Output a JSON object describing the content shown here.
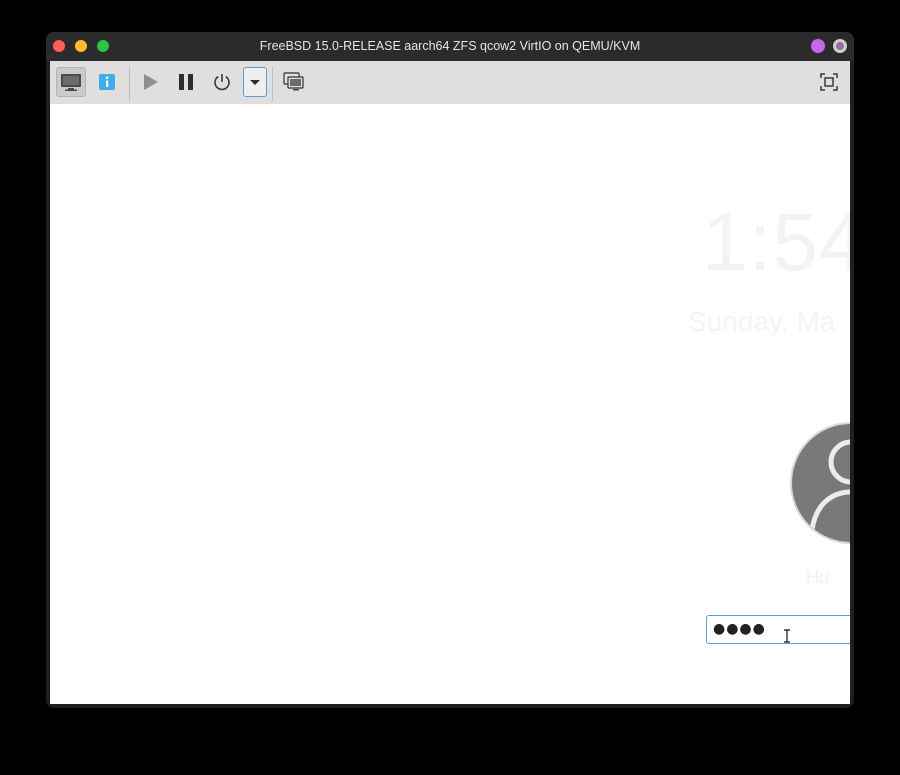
{
  "window": {
    "title": "FreeBSD 15.0-RELEASE aarch64 ZFS qcow2 VirtIO on QEMU/KVM"
  },
  "toolbar": {
    "buttons": [
      {
        "name": "display-console",
        "icon": "monitor-icon"
      },
      {
        "name": "details",
        "icon": "info-icon"
      },
      {
        "name": "run",
        "icon": "play-icon"
      },
      {
        "name": "pause",
        "icon": "pause-icon"
      },
      {
        "name": "shutdown",
        "icon": "power-icon"
      },
      {
        "name": "shutdown-menu",
        "icon": "chevron-down-icon"
      },
      {
        "name": "snapshots",
        "icon": "snapshots-icon"
      },
      {
        "name": "fullscreen",
        "icon": "fullscreen-icon"
      }
    ]
  },
  "lockscreen": {
    "time": "1:54",
    "date": "Sunday, Ma",
    "user": "Hu",
    "password_mask": "●●●●"
  },
  "colors": {
    "accent": "#58a3d6",
    "info_blue": "#3daee9",
    "close": "#fe5f57",
    "minimize": "#febc2e",
    "maximize": "#28c840"
  }
}
